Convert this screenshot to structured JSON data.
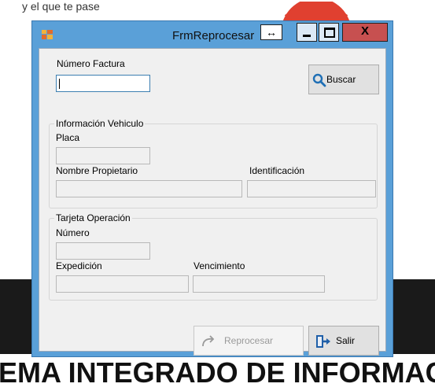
{
  "background": {
    "top_text": "y el que te pase",
    "bottom_text": "EMA INTEGRADO DE INFORMAC"
  },
  "window": {
    "title": "FrmReprocesar",
    "resize_glyph": "↔",
    "close_glyph": "X"
  },
  "form": {
    "numero_factura_label": "Número Factura",
    "numero_factura_value": "",
    "buscar_label": "Buscar",
    "vehiculo_group": "Información Vehiculo",
    "placa_label": "Placa",
    "nombre_propietario_label": "Nombre Propietario",
    "identificacion_label": "Identificación",
    "tarjeta_group": "Tarjeta Operación",
    "numero_label": "Número",
    "expedicion_label": "Expedición",
    "vencimiento_label": "Vencimiento",
    "reprocesar_label": "Reprocesar",
    "salir_label": "Salir"
  },
  "icons": {
    "app": "app-icon",
    "search": "search-icon",
    "reprocess": "redo-arrow-icon",
    "exit": "exit-door-icon"
  },
  "colors": {
    "titlebar": "#5aa0d8",
    "close_button": "#c75050",
    "active_input_border": "#3c7fb1",
    "search_icon": "#1f6fb5"
  }
}
